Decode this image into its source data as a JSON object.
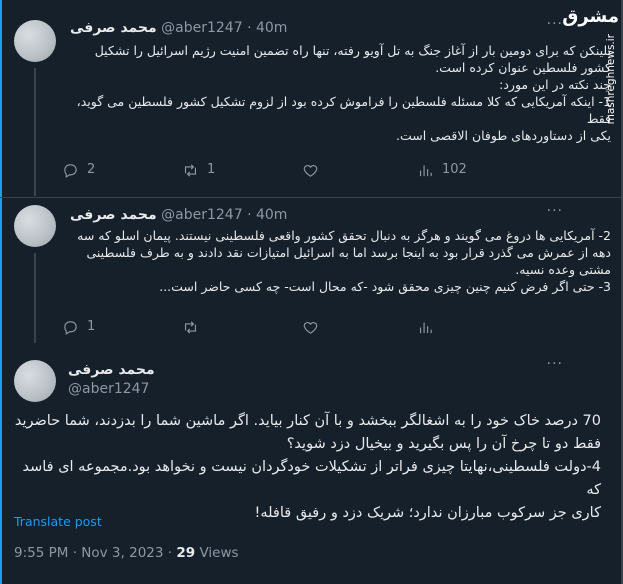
{
  "tweets": [
    {
      "name": "محمد صرفی",
      "handle": "@aber1247",
      "time": "40m",
      "lines": [
        "بلینکن که برای دومین بار از آغاز جنگ به تل آویو رفته، تنها راه تضمین امنیت رژیم اسرائیل را تشکیل",
        "کشور فلسطین عنوان کرده است.",
        "چند نکته در این مورد:",
        "1- اینکه آمریکایی که کلا مسئله فلسطین را فراموش کرده بود از لزوم تشکیل کشور فلسطین می گوید، فقط",
        "یکی از دستاوردهای طوفان الاقصی است."
      ],
      "replies": "2",
      "retweets": "1",
      "likes": "",
      "views": "102"
    },
    {
      "name": "محمد صرفی",
      "handle": "@aber1247",
      "time": "40m",
      "lines": [
        "2- آمریکایی ها دروغ می گویند و هرگز به دنبال تحقق کشور واقعی فلسطینی نیستند. پیمان اسلو که سه",
        "دهه از عمرش می گذرد قرار بود به اینجا برسد اما به اسرائیل امتیازات نقد دادند و به طرف فلسطینی",
        "مشتی وعده نسیه.",
        "3- حتی اگر فرض کنیم چنین چیزی محقق شود -که محال است- چه کسی حاضر است..."
      ],
      "replies": "1",
      "retweets": "",
      "likes": "",
      "views": ""
    }
  ],
  "main_tweet": {
    "name": "محمد صرفی",
    "handle": "@aber1247",
    "lines": [
      "70 درصد خاک خود را به اشغالگر ببخشد و با آن کنار بیاید. اگر ماشین شما را بدزدند، شما حاضرید",
      "فقط دو تا چرخ آن را پس بگیرید و بیخیال دزد شوید؟",
      "4-دولت فلسطینی،نهایتا چیزی فراتر از تشکیلات خودگردان نیست و نخواهد بود.مجموعه ای فاسد که",
      "کاری جز سرکوب مبارزان ندارد؛ شریک دزد و رفیق قافله!"
    ],
    "translate": "Translate post",
    "time": "9:55 PM",
    "date": "Nov 3, 2023",
    "views_count": "29",
    "views_label": "Views"
  },
  "watermark": {
    "logo": "مشرق",
    "site": "mashreghnews.ir"
  }
}
